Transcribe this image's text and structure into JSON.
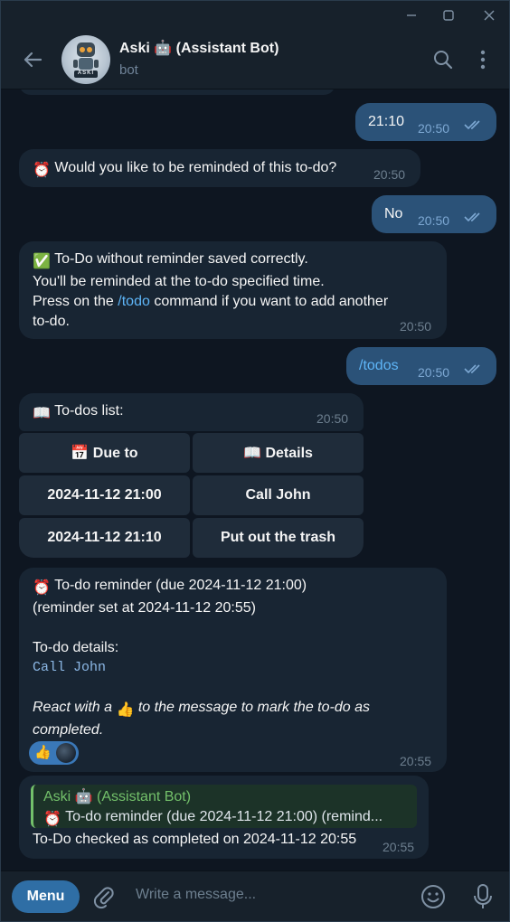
{
  "window": {
    "minimize_glyph": "—",
    "maximize_glyph": "☐",
    "close_glyph": "✕"
  },
  "header": {
    "title": "Aski 🤖 (Assistant Bot)",
    "subtitle": "bot",
    "avatar_label": "ASKI"
  },
  "messages": {
    "m1": {
      "text": "21:10",
      "time": "20:50"
    },
    "m2": {
      "emoji": "⏰",
      "text": "Would you like to be reminded of this to-do?",
      "time": "20:50"
    },
    "m3": {
      "text": "No",
      "time": "20:50"
    },
    "m4": {
      "emoji": "✅",
      "line1": "To-Do without reminder saved correctly.",
      "line2": "You'll be reminded at the to-do specified time.",
      "line3_pre": "Press on the ",
      "line3_link": "/todo",
      "line3_post": " command if you want to add another",
      "line4": "to-do.",
      "time": "20:50"
    },
    "m5": {
      "text": "/todos",
      "time": "20:50"
    },
    "m6": {
      "emoji": "📖",
      "text": "To-dos list:",
      "time": "20:50",
      "keyboard": {
        "header_due": "📅 Due to",
        "header_details": "📖 Details",
        "rows": [
          {
            "due": "2024-11-12 21:00",
            "details": "Call John"
          },
          {
            "due": "2024-11-12 21:10",
            "details": "Put out the trash"
          }
        ]
      }
    },
    "m7": {
      "emoji": "⏰",
      "line1": "To-do reminder (due 2024-11-12 21:00)",
      "line2": "(reminder set at 2024-11-12 20:55)",
      "details_label": "To-do details:",
      "details_value": "Call John",
      "react_pre": "React with a ",
      "react_emoji": "👍",
      "react_post": " to the message to mark the to-do as",
      "react_line2": "completed.",
      "reaction": "👍",
      "time": "20:55"
    },
    "m8": {
      "reply_author": "Aski 🤖 (Assistant Bot)",
      "reply_emoji": "⏰",
      "reply_text": "To-do reminder (due 2024-11-12 21:00) (remind...",
      "text": "To-Do checked as completed on 2024-11-12 20:55",
      "time": "20:55"
    }
  },
  "input": {
    "menu_label": "Menu",
    "placeholder": "Write a message..."
  },
  "colors": {
    "background": "#0e1621",
    "panel": "#17212b",
    "incoming": "#182533",
    "outgoing": "#2b5278",
    "accent": "#5eb5f7",
    "reply_accent": "#73c06a"
  }
}
